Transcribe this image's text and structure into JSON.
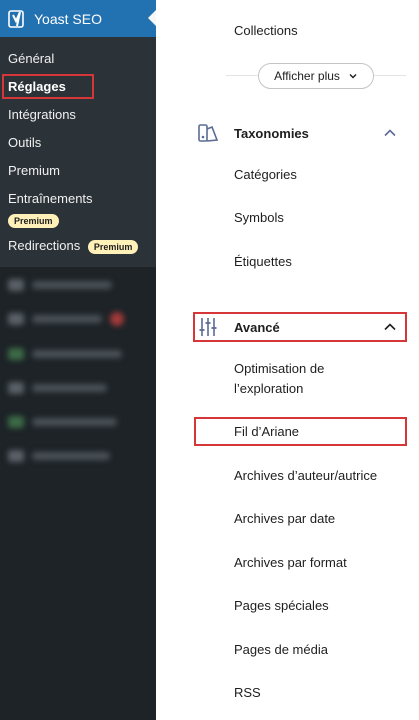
{
  "sidebar": {
    "title": "Yoast SEO",
    "items": [
      {
        "label": "Général"
      },
      {
        "label": "Réglages",
        "active": true
      },
      {
        "label": "Intégrations"
      },
      {
        "label": "Outils"
      },
      {
        "label": "Premium"
      },
      {
        "label": "Entraînements",
        "badge": "Premium"
      },
      {
        "label": "Redirections",
        "badge": "Premium"
      }
    ],
    "colors": {
      "background": "#1d2327",
      "submenu": "#2c3338",
      "header": "#2271b1",
      "badge": "#fff1b8",
      "highlight": "#d63638"
    }
  },
  "nav": {
    "collections_label": "Collections",
    "show_more_label": "Afficher plus",
    "taxonomies": {
      "title": "Taxonomies",
      "icon": "taxonomy-icon",
      "items": [
        "Catégories",
        "Symbols",
        "Étiquettes"
      ]
    },
    "advanced": {
      "title": "Avancé",
      "icon": "sliders-icon",
      "items": [
        "Optimisation de",
        "l’exploration",
        "Fil d’Ariane",
        "Archives d’auteur/autrice",
        "Archives par date",
        "Archives par format",
        "Pages spéciales",
        "Pages de média",
        "RSS"
      ]
    }
  }
}
